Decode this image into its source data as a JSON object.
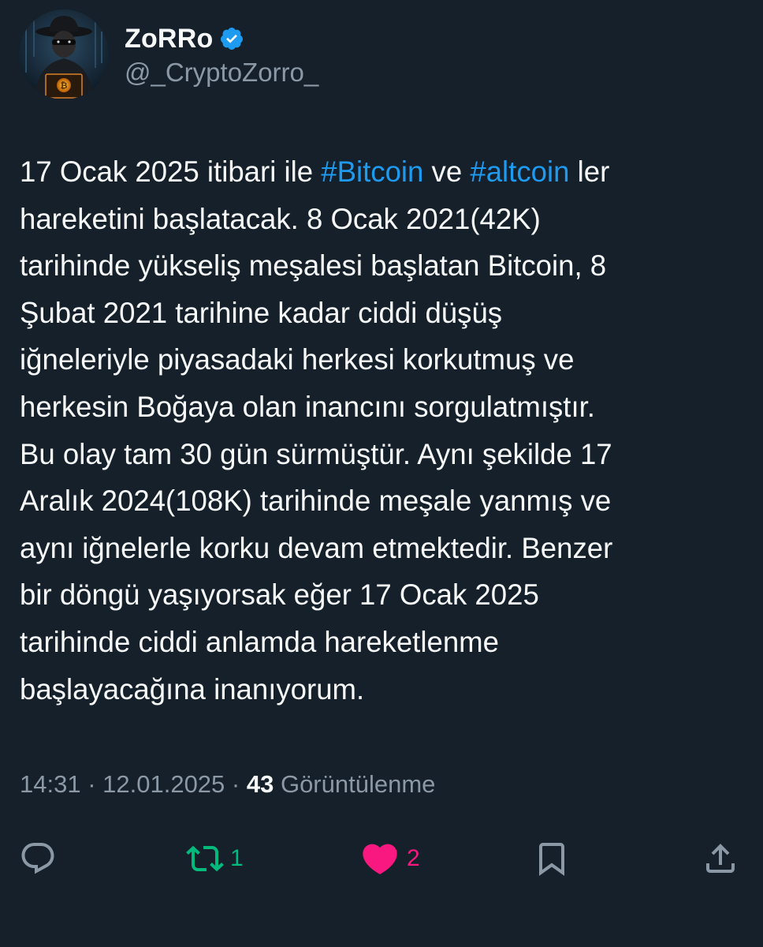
{
  "author": {
    "display_name": "ZoRRo",
    "handle": "@_CryptoZorro_",
    "verified_icon": "verified-badge-icon",
    "avatar_icon": "zorro-hacker-avatar"
  },
  "tweet": {
    "lines": [
      {
        "t1": "17 Ocak 2025 itibari ile ",
        "h1": "#Bitcoin",
        "t2": " ve ",
        "h2": "#altcoin",
        "t3": " ler"
      },
      "hareketini başlatacak. 8 Ocak 2021(42K)",
      "tarihinde yükseliş meşalesi başlatan Bitcoin, 8",
      "Şubat 2021 tarihine kadar ciddi düşüş",
      "iğneleriyle piyasadaki herkesi korkutmuş ve",
      "herkesin Boğaya olan inancını sorgulatmıştır.",
      "Bu olay tam 30 gün sürmüştür. Aynı şekilde 17",
      "Aralık 2024(108K) tarihinde meşale yanmış ve",
      "aynı iğnelerle korku devam etmektedir. Benzer",
      "bir döngü yaşıyorsak eğer 17 Ocak 2025",
      "tarihinde ciddi anlamda hareketlenme",
      "başlayacağına inanıyorum."
    ]
  },
  "meta": {
    "time": "14:31",
    "sep1": " · ",
    "date": "12.01.2025",
    "sep2": " · ",
    "views_count": "43",
    "views_label": " Görüntülenme"
  },
  "actions": {
    "reply": {
      "icon": "reply-icon"
    },
    "retweet": {
      "icon": "retweet-icon",
      "count": "1"
    },
    "like": {
      "icon": "heart-icon",
      "count": "2"
    },
    "bookmark": {
      "icon": "bookmark-icon"
    },
    "share": {
      "icon": "share-icon"
    }
  },
  "colors": {
    "background": "#15202b",
    "text": "#f7f9f9",
    "secondary": "#8b98a5",
    "link": "#1d9bf0",
    "retweet": "#00ba7c",
    "like": "#f91880"
  }
}
